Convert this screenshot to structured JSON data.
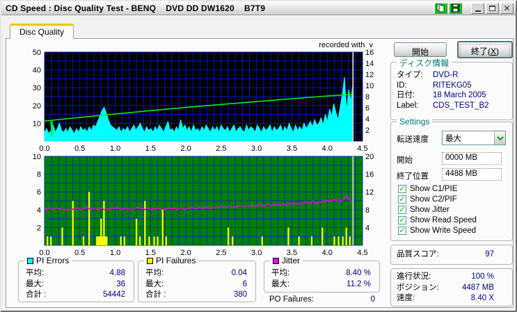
{
  "window": {
    "title": "CD Speed : Disc Quality Test - BENQ    DVD DD DW1620    B7T9"
  },
  "icons": {
    "close": "✕",
    "check": "✓"
  },
  "tab": {
    "label": "Disc Quality"
  },
  "watermark": "recorded with  v",
  "actions": {
    "start": "開始",
    "exit_prefix": "終了(",
    "exit_key": "X",
    "exit_suffix": ")"
  },
  "disc_info": {
    "title": "ディスク情報",
    "rows": [
      {
        "label": "タイプ:",
        "value": "DVD-R"
      },
      {
        "label": "ID:",
        "value": "RITEKG05"
      },
      {
        "label": "日付:",
        "value": "18 March 2005"
      },
      {
        "label": "Label:",
        "value": "CDS_TEST_B2"
      }
    ]
  },
  "settings": {
    "title": "Settings",
    "speed_label": "転送速度",
    "speed_value": "最大",
    "start_label": "開始",
    "start_value": "0000 MB",
    "end_label": "終了位置",
    "end_value": "4488 MB",
    "checkboxes": [
      {
        "label": "Show C1/PIE",
        "checked": true
      },
      {
        "label": "Show C2/PIF",
        "checked": true
      },
      {
        "label": "Show Jitter",
        "checked": true
      },
      {
        "label": "Show Read Speed",
        "checked": true
      },
      {
        "label": "Show Write Speed",
        "checked": true
      }
    ]
  },
  "quality": {
    "label": "品質スコア:",
    "value": "97"
  },
  "progress": {
    "rows": [
      {
        "label": "進行状況:",
        "value": "100 %"
      },
      {
        "label": "ポジション:",
        "value": "4487 MB"
      },
      {
        "label": "速度:",
        "value": "8.40 X"
      }
    ]
  },
  "stats": {
    "pi_errors": {
      "title": "PI Errors",
      "color": "#00ffff",
      "rows": [
        {
          "label": "平均:",
          "value": "4.88"
        },
        {
          "label": "最大:",
          "value": "36"
        },
        {
          "label": "合計 :",
          "value": "54442"
        }
      ]
    },
    "pi_failures": {
      "title": "PI Failures",
      "color": "#ffff00",
      "rows": [
        {
          "label": "平均:",
          "value": "0.04"
        },
        {
          "label": "最大:",
          "value": "6"
        },
        {
          "label": "合計 :",
          "value": "380"
        }
      ]
    },
    "jitter": {
      "title": "Jitter",
      "color": "#ff00ff",
      "rows": [
        {
          "label": "平均:",
          "value": "8.40 %"
        },
        {
          "label": "最大:",
          "value": "11.2 %"
        }
      ]
    },
    "po_failures": {
      "label": "PO Failures:",
      "value": "0"
    }
  },
  "chart_data": [
    {
      "type": "area",
      "title": "PI Errors and Read Speed vs disc position (GB)",
      "bg": "#000000",
      "grid": {
        "x_step": 0.1,
        "y_step": 5,
        "color": "#0016c4"
      },
      "x_min": 0,
      "x_max": 4.5,
      "x_ticks": [
        "0.0",
        "0.5",
        "1.0",
        "1.5",
        "2.0",
        "2.5",
        "3.0",
        "3.5",
        "4.0",
        "4.5"
      ],
      "left_axis": {
        "min": 0,
        "max": 50,
        "ticks": [
          10,
          20,
          30,
          40,
          50
        ]
      },
      "right_axis": {
        "min": 0,
        "max": 16,
        "ticks": [
          2,
          4,
          6,
          8,
          10,
          12,
          14,
          16
        ]
      },
      "cursor_x": 4.365,
      "series": [
        {
          "name": "PI Errors",
          "type": "area",
          "color": "#00ffff",
          "x_start": 0,
          "x_step": 0.0301,
          "values": [
            5,
            7,
            4,
            6,
            9,
            5,
            7,
            10,
            6,
            5,
            7,
            5,
            8,
            6,
            4,
            7,
            5,
            8,
            6,
            7,
            5,
            8,
            6,
            9,
            8,
            11,
            14,
            17,
            19,
            16,
            12,
            9,
            8,
            7,
            6,
            8,
            5,
            7,
            6,
            8,
            5,
            7,
            9,
            6,
            8,
            10,
            7,
            5,
            8,
            6,
            7,
            5,
            8,
            6,
            9,
            7,
            5,
            8,
            11,
            6,
            7,
            5,
            8,
            6,
            12,
            7,
            9,
            6,
            8,
            5,
            9,
            6,
            7,
            5,
            8,
            6,
            9,
            7,
            5,
            8,
            6,
            8,
            5,
            9,
            7,
            6,
            8,
            5,
            7,
            9,
            5,
            7,
            8,
            6,
            5,
            9,
            6,
            8,
            7,
            5,
            9,
            7,
            5,
            8,
            6,
            7,
            9,
            5,
            8,
            6,
            7,
            9,
            5,
            8,
            6,
            10,
            7,
            5,
            9,
            6,
            8,
            6,
            10,
            7,
            9,
            11,
            8,
            12,
            9,
            10,
            13,
            9,
            15,
            11,
            18,
            14,
            21,
            16,
            12,
            19,
            26,
            36,
            17,
            29,
            22,
            33
          ]
        },
        {
          "name": "Read Speed",
          "type": "line",
          "color": "#00ee00",
          "points": [
            [
              0,
              11.3
            ],
            [
              0.09,
              11.6
            ],
            [
              0.1,
              2.3
            ],
            [
              0.11,
              11.7
            ],
            [
              0.5,
              13.3
            ],
            [
              1.0,
              15.2
            ],
            [
              1.5,
              17.1
            ],
            [
              2.0,
              18.9
            ],
            [
              2.5,
              20.6
            ],
            [
              3.0,
              22.2
            ],
            [
              3.5,
              23.8
            ],
            [
              4.0,
              25.3
            ],
            [
              4.37,
              26.3
            ]
          ]
        }
      ]
    },
    {
      "type": "bar",
      "title": "PI Failures and Jitter vs disc position (GB)",
      "bg": "#008000",
      "grid": {
        "x_step": 0.1,
        "y_step": 1,
        "color": "#0030b8"
      },
      "x_min": 0,
      "x_max": 4.5,
      "x_ticks": [
        "0.0",
        "0.5",
        "1.0",
        "1.5",
        "2.0",
        "2.5",
        "3.0",
        "3.5",
        "4.0",
        "4.5"
      ],
      "left_axis": {
        "min": 0,
        "max": 10,
        "ticks": [
          2,
          4,
          6,
          8,
          10
        ]
      },
      "right_axis": {
        "min": 0,
        "max": 20,
        "ticks": [
          4,
          8,
          12,
          16,
          20
        ]
      },
      "cursor_x": 4.365,
      "series": [
        {
          "name": "PI Failures",
          "type": "bars",
          "color": "#ffff00",
          "points": [
            [
              0.04,
              1
            ],
            [
              0.09,
              1
            ],
            [
              0.25,
              2
            ],
            [
              0.4,
              5
            ],
            [
              0.55,
              1
            ],
            [
              0.63,
              6
            ],
            [
              0.74,
              1
            ],
            [
              0.76,
              1
            ],
            [
              0.78,
              1
            ],
            [
              0.8,
              3
            ],
            [
              0.82,
              1
            ],
            [
              0.84,
              5
            ],
            [
              0.86,
              1
            ],
            [
              0.88,
              1
            ],
            [
              1.08,
              1
            ],
            [
              1.13,
              1
            ],
            [
              1.3,
              3
            ],
            [
              1.35,
              1
            ],
            [
              1.42,
              5
            ],
            [
              1.48,
              1
            ],
            [
              1.55,
              1
            ],
            [
              1.6,
              1
            ],
            [
              1.67,
              4
            ],
            [
              1.72,
              1
            ],
            [
              2.6,
              2
            ],
            [
              2.66,
              1
            ],
            [
              3.08,
              1
            ],
            [
              3.45,
              2
            ],
            [
              3.6,
              1
            ],
            [
              3.78,
              1
            ],
            [
              3.93,
              2
            ],
            [
              4.1,
              1
            ],
            [
              4.16,
              1
            ],
            [
              4.22,
              1
            ],
            [
              4.27,
              2
            ],
            [
              4.32,
              1
            ]
          ]
        },
        {
          "name": "Jitter",
          "type": "line",
          "color": "#ee00ee",
          "x_start": 0,
          "x_step": 0.0301,
          "values": [
            4.1,
            4.0,
            4.2,
            4.1,
            4.0,
            4.1,
            4.2,
            4.0,
            4.1,
            4.0,
            4.0,
            4.1,
            3.9,
            4.1,
            4.0,
            4.2,
            4.1,
            4.0,
            4.1,
            4.2,
            4.3,
            4.1,
            4.0,
            4.2,
            4.1,
            4.0,
            4.1,
            4.2,
            4.0,
            4.1,
            4.1,
            4.0,
            4.2,
            4.1,
            4.3,
            4.1,
            4.0,
            4.1,
            4.2,
            4.0,
            4.1,
            4.0,
            4.1,
            4.2,
            4.3,
            4.1,
            4.2,
            4.0,
            4.1,
            4.2,
            4.0,
            4.1,
            4.0,
            4.2,
            4.1,
            4.0,
            4.1,
            4.0,
            4.2,
            4.1,
            4.1,
            4.2,
            4.0,
            4.1,
            4.2,
            4.1,
            4.0,
            4.2,
            4.1,
            4.3,
            4.2,
            4.1,
            4.2,
            4.3,
            4.1,
            4.2,
            4.3,
            4.2,
            4.1,
            4.3,
            4.2,
            4.3,
            4.2,
            4.4,
            4.3,
            4.2,
            4.3,
            4.4,
            4.3,
            4.2,
            4.4,
            4.3,
            4.5,
            4.4,
            4.3,
            4.5,
            4.4,
            4.6,
            4.4,
            4.5,
            4.4,
            4.5,
            4.6,
            4.4,
            4.5,
            4.6,
            4.5,
            4.4,
            4.6,
            4.5,
            4.6,
            4.5,
            4.7,
            4.6,
            4.5,
            4.7,
            4.6,
            4.8,
            4.6,
            4.7,
            4.6,
            4.8,
            4.7,
            4.9,
            4.7,
            4.8,
            5.0,
            4.8,
            4.7,
            4.9,
            4.8,
            5.0,
            4.9,
            5.1,
            4.9,
            5.0,
            5.2,
            5.0,
            5.1,
            4.9,
            5.1,
            5.3,
            5.6,
            5.2,
            5.0,
            5.1
          ]
        }
      ]
    }
  ]
}
